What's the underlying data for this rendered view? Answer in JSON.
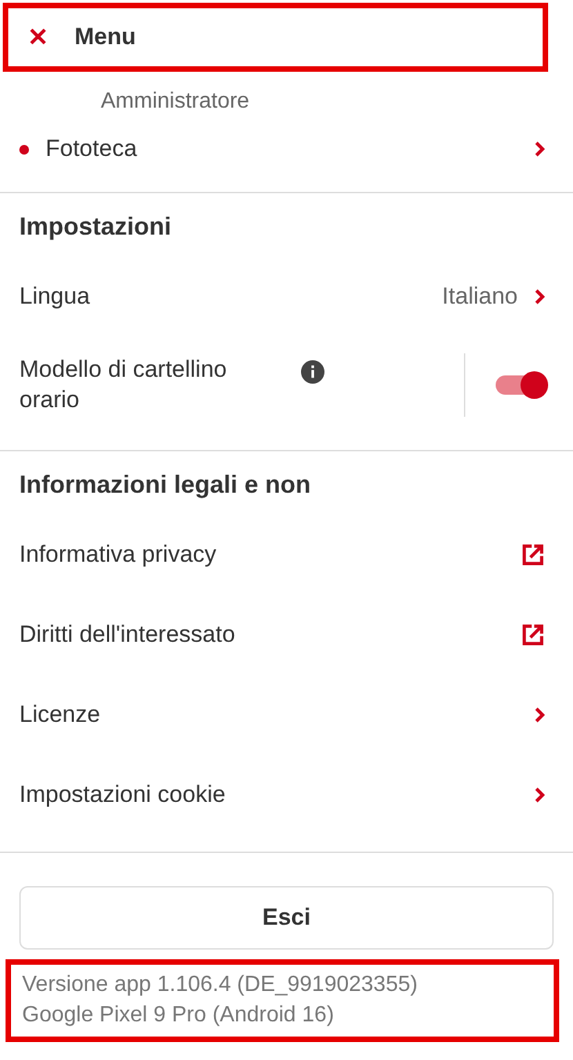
{
  "header": {
    "close_icon": "✕",
    "title": "Menu",
    "highlighted": true
  },
  "account": {
    "role": "Amministratore",
    "items": [
      {
        "kind": "link",
        "label": "Fototeca",
        "color": "#d0021b"
      }
    ]
  },
  "sections": [
    {
      "title": "Impostazioni",
      "items": [
        {
          "kind": "link",
          "label": "Lingua",
          "value": "Italiano"
        },
        {
          "kind": "toggle",
          "label": "Modello di cartellino orario",
          "info": true,
          "on": true
        }
      ]
    },
    {
      "title": "Informazioni legali e non",
      "items": [
        {
          "kind": "external",
          "label": "Informativa privacy"
        },
        {
          "kind": "external",
          "label": "Diritti dell'interessato"
        },
        {
          "kind": "link",
          "label": "Licenze"
        },
        {
          "kind": "link",
          "label": "Impostazioni cookie"
        }
      ]
    }
  ],
  "logout_button": "Esci",
  "footer": {
    "lines": [
      "Versione app 1.106.4 (DE_9919023355)",
      "Google Pixel 9 Pro (Android 16)"
    ],
    "highlighted": true
  }
}
